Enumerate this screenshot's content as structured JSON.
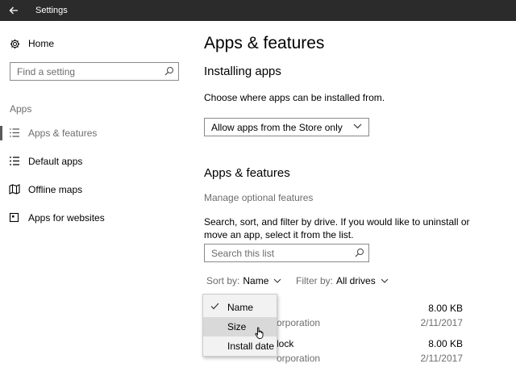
{
  "window": {
    "title": "Settings"
  },
  "sidebar": {
    "home_label": "Home",
    "search_placeholder": "Find a setting",
    "section_label": "Apps",
    "items": [
      {
        "label": "Apps & features",
        "icon": "list-icon",
        "active": true
      },
      {
        "label": "Default apps",
        "icon": "default-apps-icon",
        "active": false
      },
      {
        "label": "Offline maps",
        "icon": "map-icon",
        "active": false
      },
      {
        "label": "Apps for websites",
        "icon": "web-app-icon",
        "active": false
      }
    ]
  },
  "main": {
    "title": "Apps & features",
    "installing": {
      "heading": "Installing apps",
      "description": "Choose where apps can be installed from.",
      "dropdown_value": "Allow apps from the Store only"
    },
    "apps": {
      "heading": "Apps & features",
      "optional_link": "Manage optional features",
      "description": "Search, sort, and filter by drive. If you would like to uninstall or move an app, select it from the list.",
      "search_placeholder": "Search this list",
      "sort_label": "Sort by:",
      "sort_value": "Name",
      "filter_label": "Filter by:",
      "filter_value": "All drives",
      "list": [
        {
          "name": "",
          "publisher": "orporation",
          "size": "8.00 KB",
          "date": "2/11/2017"
        },
        {
          "name": "lock",
          "publisher": "orporation",
          "size": "8.00 KB",
          "date": "2/11/2017"
        }
      ]
    }
  },
  "sort_menu": {
    "options": [
      {
        "label": "Name",
        "checked": true,
        "hover": false
      },
      {
        "label": "Size",
        "checked": false,
        "hover": true
      },
      {
        "label": "Install date",
        "checked": false,
        "hover": false
      }
    ]
  },
  "colors": {
    "titlebar": "#2b2b2b",
    "muted_text": "#6d6d6d",
    "menu_bg": "#f2f2f2",
    "menu_hover": "#d9d9d9"
  }
}
